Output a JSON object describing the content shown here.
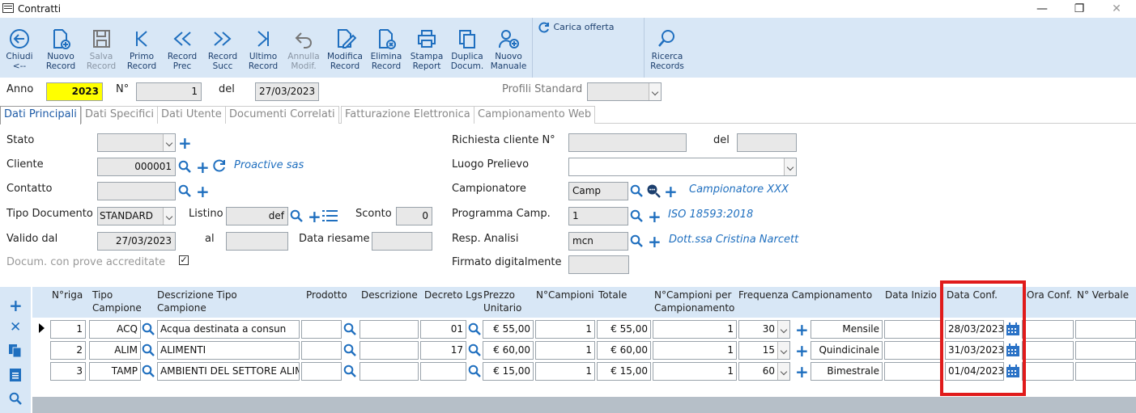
{
  "window": {
    "title": "Contratti",
    "minimize": "—",
    "restore": "❐",
    "close": "✕"
  },
  "ribbon": [
    {
      "line1": "Chiudi",
      "line2": "<--",
      "icon": "back-arrow-icon",
      "enabled": true
    },
    {
      "line1": "Nuovo",
      "line2": "Record",
      "icon": "new-document-icon",
      "enabled": true
    },
    {
      "line1": "Salva",
      "line2": "Record",
      "icon": "save-icon",
      "enabled": false
    },
    {
      "line1": "Primo",
      "line2": "Record",
      "icon": "first-record-icon",
      "enabled": true
    },
    {
      "line1": "Record",
      "line2": "Prec",
      "icon": "previous-record-icon",
      "enabled": true
    },
    {
      "line1": "Record",
      "line2": "Succ",
      "icon": "next-record-icon",
      "enabled": true
    },
    {
      "line1": "Ultimo",
      "line2": "Record",
      "icon": "last-record-icon",
      "enabled": true
    },
    {
      "line1": "Annulla",
      "line2": "Modif.",
      "icon": "undo-icon",
      "enabled": false
    },
    {
      "line1": "Modifica",
      "line2": "Record",
      "icon": "edit-document-icon",
      "enabled": true
    },
    {
      "line1": "Elimina",
      "line2": "Record",
      "icon": "delete-document-icon",
      "enabled": true
    },
    {
      "line1": "Stampa",
      "line2": "Report",
      "icon": "printer-icon",
      "enabled": true
    },
    {
      "line1": "Duplica",
      "line2": "Docum.",
      "icon": "duplicate-icon",
      "enabled": true
    },
    {
      "line1": "Nuovo",
      "line2": "Manuale",
      "icon": "new-user-icon",
      "enabled": true
    },
    {
      "line1": "Ricerca",
      "line2": "Records",
      "icon": "search-icon",
      "enabled": true
    }
  ],
  "carica_offerta": "Carica offerta",
  "header": {
    "anno_label": "Anno",
    "anno": "2023",
    "num_label": "N°",
    "num": "1",
    "del_label": "del",
    "data": "27/03/2023",
    "profili_label": "Profili Standard",
    "profili_value": ""
  },
  "tabs": [
    "Dati Principali",
    "Dati Specifici",
    "Dati Utente",
    "Documenti Correlati",
    "Fatturazione Elettronica",
    "Campionamento Web"
  ],
  "form": {
    "stato_label": "Stato",
    "stato": "",
    "cliente_label": "Cliente",
    "cliente": "000001",
    "cliente_name": "Proactive sas",
    "contatto_label": "Contatto",
    "contatto": "",
    "tipo_doc_label": "Tipo Documento",
    "tipo_doc": "STANDARD",
    "listino_label": "Listino",
    "listino": "def",
    "sconto_label": "Sconto",
    "sconto": "0",
    "valido_label": "Valido dal",
    "valido": "27/03/2023",
    "al_label": "al",
    "al": "",
    "riesame_label": "Data riesame",
    "riesame": "",
    "docum_label": "Docum. con prove accreditate",
    "docum_checked": true,
    "richiesta_label": "Richiesta cliente N°",
    "richiesta": "",
    "richiesta_del_label": "del",
    "richiesta_del": "",
    "luogo_label": "Luogo Prelievo",
    "luogo": "",
    "campionatore_label": "Campionatore",
    "campionatore": "Camp",
    "campionatore_name": "Campionatore XXX",
    "programma_label": "Programma Camp.",
    "programma": "1",
    "programma_name": "ISO 18593:2018",
    "resp_label": "Resp. Analisi",
    "resp": "mcn",
    "resp_name": "Dott.ssa Cristina Narcett",
    "firmato_label": "Firmato digitalmente",
    "firmato": ""
  },
  "grid": {
    "headers": {
      "nriga": "N°riga",
      "tipo1": "Tipo",
      "tipo2": "Campione",
      "desc1": "Descrizione Tipo",
      "desc2": "Campione",
      "prodotto": "Prodotto",
      "descrizione": "Descrizione",
      "decreto": "Decreto Lgs",
      "prezzo1": "Prezzo",
      "prezzo2": "Unitario",
      "ncamp": "N°Campioni",
      "totale": "Totale",
      "ncpc1": "N°Campioni per",
      "ncpc2": "Campionamento",
      "freq": "Frequenza Campionamento",
      "inizio": "Data Inizio",
      "conf": "Data Conf.",
      "ora": "Ora Conf.",
      "verbale": "N° Verbale"
    },
    "rows": [
      {
        "nriga": "1",
        "tipo": "ACQ",
        "desc": "Acqua destinata a consun",
        "prodotto": "",
        "descrizione": "",
        "decreto": "01",
        "prezzo": "€ 55,00",
        "ncamp": "1",
        "totale": "€ 55,00",
        "ncpc": "1",
        "freq_n": "30",
        "freq": "Mensile",
        "inizio": "",
        "conf": "28/03/2023",
        "ora": "",
        "verbale": ""
      },
      {
        "nriga": "2",
        "tipo": "ALIM",
        "desc": "ALIMENTI",
        "prodotto": "",
        "descrizione": "",
        "decreto": "17",
        "prezzo": "€ 60,00",
        "ncamp": "1",
        "totale": "€ 60,00",
        "ncpc": "1",
        "freq_n": "15",
        "freq": "Quindicinale",
        "inizio": "",
        "conf": "31/03/2023",
        "ora": "",
        "verbale": ""
      },
      {
        "nriga": "3",
        "tipo": "TAMP",
        "desc": "AMBIENTI DEL SETTORE ALIMI",
        "prodotto": "",
        "descrizione": "",
        "decreto": "",
        "prezzo": "€ 15,00",
        "ncamp": "1",
        "totale": "€ 15,00",
        "ncpc": "1",
        "freq_n": "60",
        "freq": "Bimestrale",
        "inizio": "",
        "conf": "01/04/2023",
        "ora": "",
        "verbale": ""
      }
    ]
  }
}
